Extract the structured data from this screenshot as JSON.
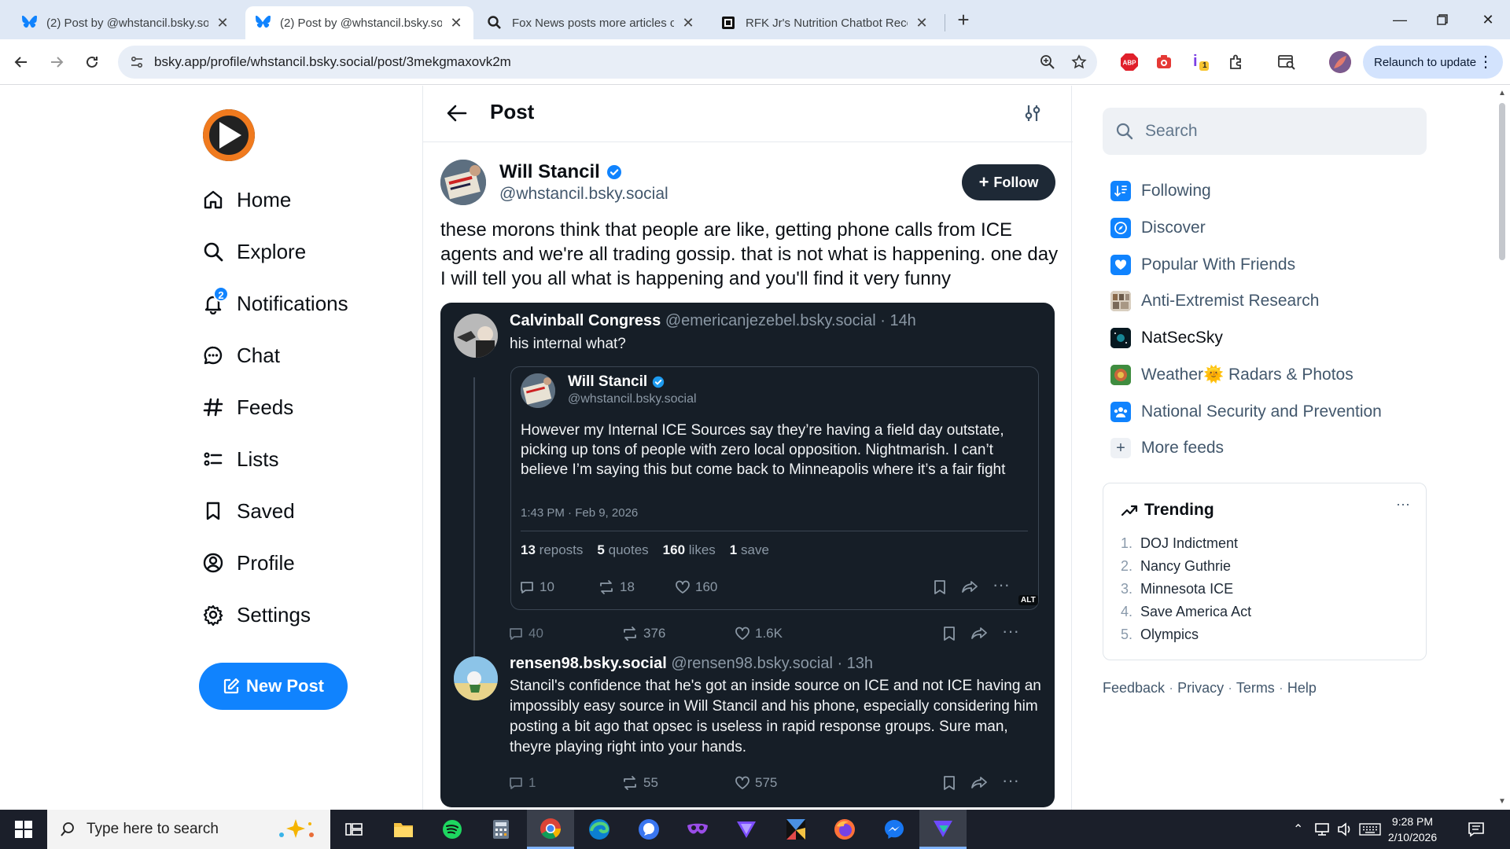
{
  "browser": {
    "tabs": [
      {
        "title": "(2) Post by @whstancil.bsky.soc",
        "active": false,
        "icon": "bluesky-butterfly-icon"
      },
      {
        "title": "(2) Post by @whstancil.bsky.soc",
        "active": true,
        "icon": "bluesky-butterfly-icon"
      },
      {
        "title": "Fox News posts more articles o",
        "active": false,
        "icon": "search-icon"
      },
      {
        "title": "RFK Jr's Nutrition Chatbot Reco",
        "active": false,
        "icon": "site-icon"
      }
    ],
    "url": "bsky.app/profile/whstancil.bsky.social/post/3mekgmaxovk2m",
    "relaunch_label": "Relaunch to update",
    "ext_badge": "1"
  },
  "nav": {
    "items": [
      {
        "label": "Home",
        "icon": "home-icon"
      },
      {
        "label": "Explore",
        "icon": "search-icon"
      },
      {
        "label": "Notifications",
        "icon": "bell-icon",
        "badge": "2"
      },
      {
        "label": "Chat",
        "icon": "chat-icon"
      },
      {
        "label": "Feeds",
        "icon": "hash-icon"
      },
      {
        "label": "Lists",
        "icon": "list-icon"
      },
      {
        "label": "Saved",
        "icon": "bookmark-icon"
      },
      {
        "label": "Profile",
        "icon": "profile-icon"
      },
      {
        "label": "Settings",
        "icon": "gear-icon"
      }
    ],
    "new_post_label": "New Post"
  },
  "post": {
    "header_title": "Post",
    "author_name": "Will Stancil",
    "author_handle": "@whstancil.bsky.social",
    "follow_label": "Follow",
    "text": "these morons think that people are like, getting phone calls from ICE agents and we're all trading gossip. that is not what is happening. one day I will tell you all what is happening and you'll find it very funny"
  },
  "screenshot": {
    "reply1": {
      "name": "Calvinball Congress",
      "meta": "@emericanjezebel.bsky.social · 14h",
      "text": "his internal what?",
      "replies": "40",
      "reposts": "376",
      "likes": "1.6K"
    },
    "quote": {
      "name": "Will Stancil",
      "handle": "@whstancil.bsky.social",
      "text": "However my Internal ICE Sources say they’re having a field day outstate, picking up tons of people with zero local opposition. Nightmarish. I can’t believe I’m saying this but come back to Minneapolis where it’s a fair fight",
      "time": "1:43 PM · Feb 9, 2026",
      "reposts_count": "13",
      "reposts_label": "reposts",
      "quotes_count": "5",
      "quotes_label": "quotes",
      "likes_count": "160",
      "likes_label": "likes",
      "saves_count": "1",
      "saves_label": "save",
      "replies": "10",
      "reposts": "18",
      "likes": "160",
      "alt_label": "ALT"
    },
    "reply2": {
      "name": "rensen98.bsky.social",
      "meta": "@rensen98.bsky.social · 13h",
      "text": "Stancil's confidence that he's got an inside source on ICE and not ICE having an impossibly easy source in Will Stancil and his phone, especially considering him posting a bit ago that opsec is useless in rapid response groups. Sure man, theyre playing right into your hands.",
      "replies": "1",
      "reposts": "55",
      "likes": "575"
    }
  },
  "right": {
    "search_placeholder": "Search",
    "feeds": [
      {
        "label": "Following",
        "icon": "following-feed-icon",
        "color": "#1083fe"
      },
      {
        "label": "Discover",
        "icon": "discover-feed-icon",
        "color": "#1083fe"
      },
      {
        "label": "Popular With Friends",
        "icon": "heart-feed-icon",
        "color": "#1083fe"
      },
      {
        "label": "Anti-Extremist Research",
        "icon": "research-feed-icon",
        "color": "#8a7a6a"
      },
      {
        "label": "NatSecSky",
        "icon": "natsec-feed-icon",
        "color": "#0b2430"
      },
      {
        "label": "Weather🌞 Radars & Photos",
        "icon": "weather-feed-icon",
        "color": "#4e9a4a"
      },
      {
        "label": "National Security and Prevention",
        "icon": "people-feed-icon",
        "color": "#1083fe"
      }
    ],
    "more_feeds_label": "More feeds",
    "trending_title": "Trending",
    "trending": [
      {
        "n": "1.",
        "label": "DOJ Indictment"
      },
      {
        "n": "2.",
        "label": "Nancy Guthrie"
      },
      {
        "n": "3.",
        "label": "Minnesota ICE"
      },
      {
        "n": "4.",
        "label": "Save America Act"
      },
      {
        "n": "5.",
        "label": "Olympics"
      }
    ],
    "footer": {
      "feedback": "Feedback",
      "privacy": "Privacy",
      "terms": "Terms",
      "help": "Help",
      "sep": "·"
    }
  },
  "taskbar": {
    "search_placeholder": "Type here to search",
    "time": "9:28 PM",
    "date": "2/10/2026"
  }
}
